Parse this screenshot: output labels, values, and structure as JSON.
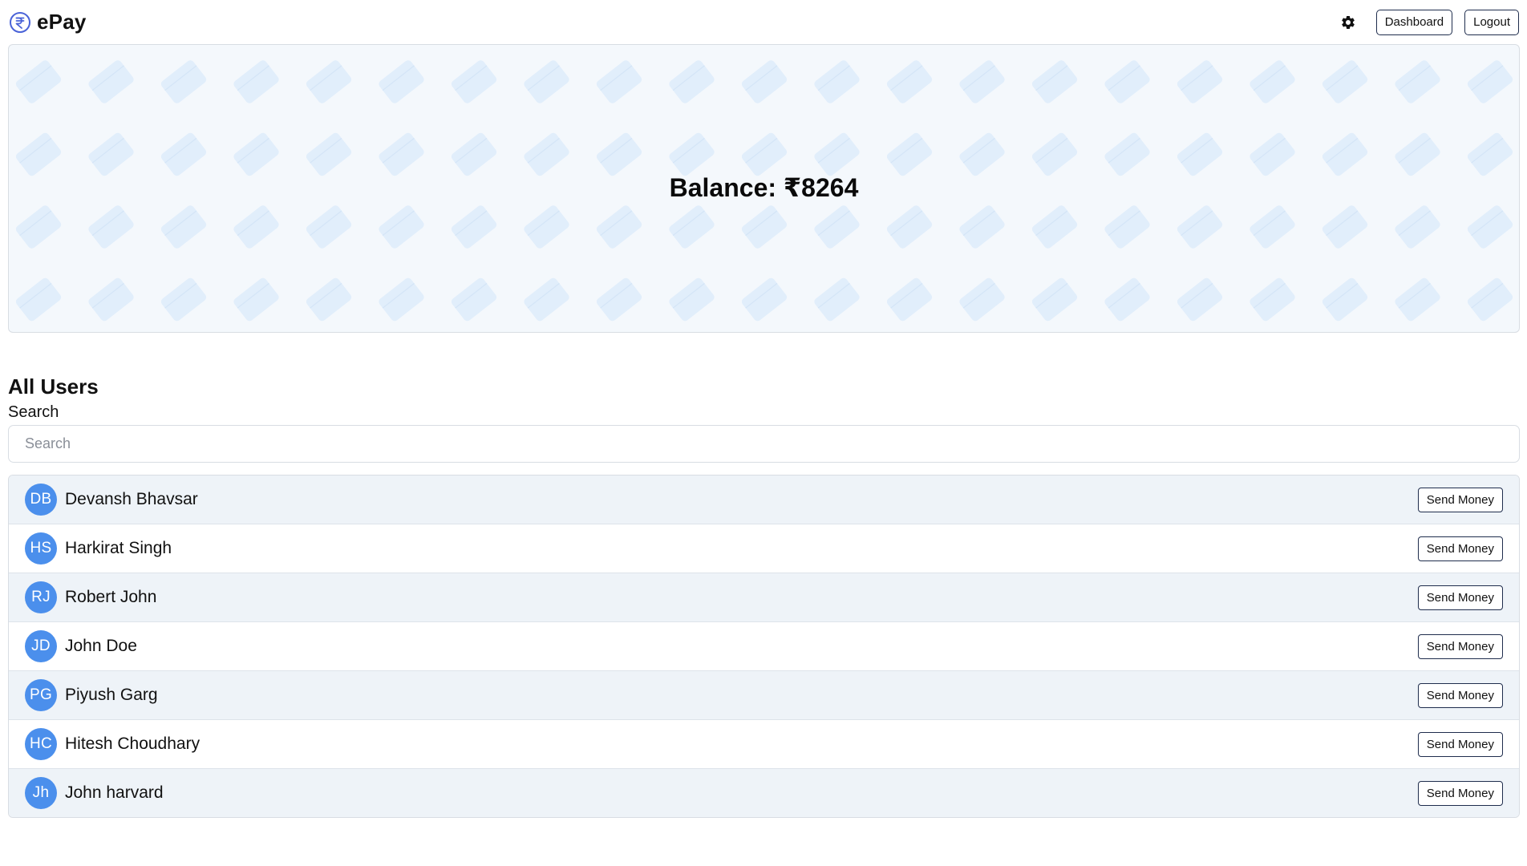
{
  "header": {
    "brand_name": "ePay",
    "settings_icon": "gear-icon",
    "logo_icon": "rupee-circle-icon",
    "dashboard_label": "Dashboard",
    "logout_label": "Logout"
  },
  "balance": {
    "text": "Balance: ₹8264",
    "background_pattern": "credit-card-icon"
  },
  "users_section": {
    "title": "All Users",
    "search_label": "Search",
    "search_placeholder": "Search",
    "search_value": "",
    "send_label": "Send Money",
    "users": [
      {
        "initials": "DB",
        "name": "Devansh Bhavsar"
      },
      {
        "initials": "HS",
        "name": "Harkirat Singh"
      },
      {
        "initials": "RJ",
        "name": "Robert John"
      },
      {
        "initials": "JD",
        "name": "John Doe"
      },
      {
        "initials": "PG",
        "name": "Piyush Garg"
      },
      {
        "initials": "HC",
        "name": "Hitesh Choudhary"
      },
      {
        "initials": "Jh",
        "name": "John harvard"
      }
    ]
  },
  "colors": {
    "accent": "#4b8fec",
    "banner_bg": "#f4f8fc",
    "row_alt_bg": "#eef3f8",
    "pattern_card": "#e1eefb",
    "button_border": "#1f2d4d"
  }
}
